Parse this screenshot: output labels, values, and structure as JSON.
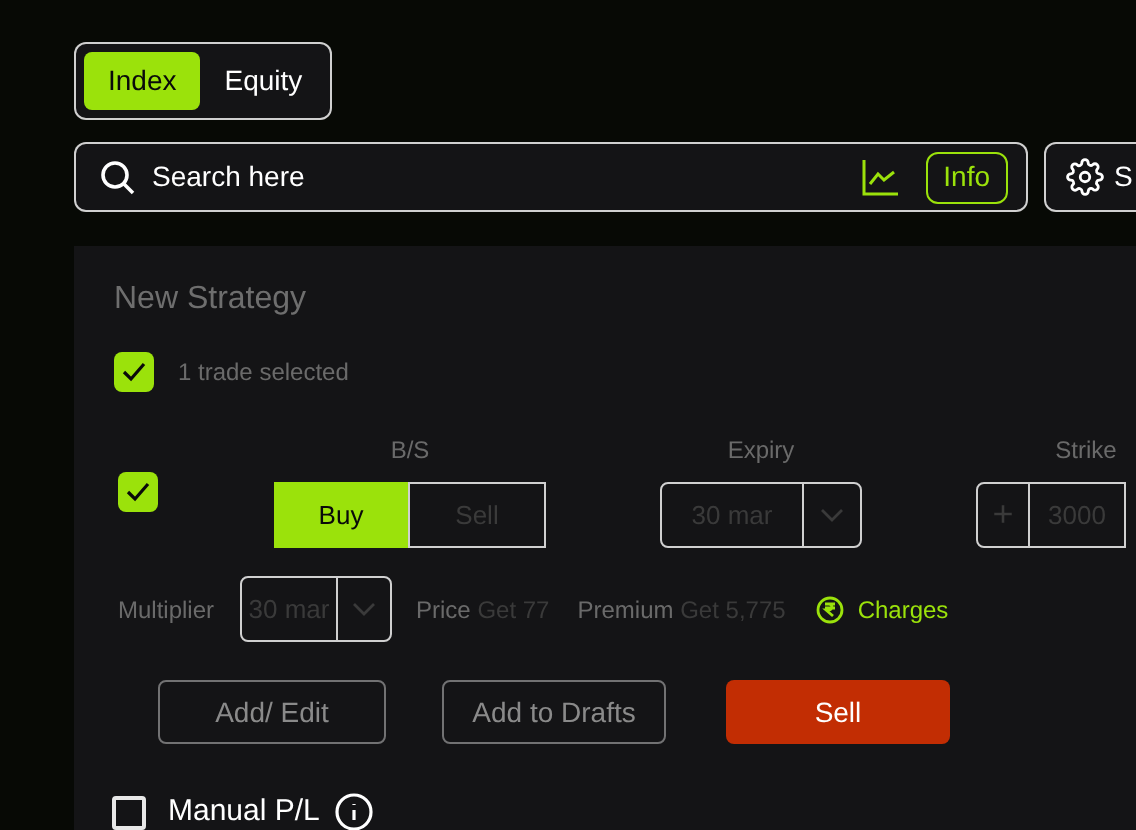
{
  "segment_tabs": [
    {
      "label": "Index",
      "selected": true
    },
    {
      "label": "Equity",
      "selected": false
    }
  ],
  "search": {
    "placeholder": "Search here",
    "info_button": "Info"
  },
  "settings_button": {
    "label": "S"
  },
  "strategy": {
    "title": "New Strategy",
    "select_all": {
      "checked": true,
      "label": "1 trade selected"
    },
    "trade": {
      "checked": true,
      "bs_label": "B/S",
      "bs_options": [
        {
          "label": "Buy",
          "selected": true
        },
        {
          "label": "Sell",
          "selected": false
        }
      ],
      "expiry_label": "Expiry",
      "expiry_value": "30 mar",
      "strike_label": "Strike",
      "strike_step": "+",
      "strike_value": "3000"
    },
    "multiplier": {
      "label": "Multiplier",
      "value": "30 mar"
    },
    "price": {
      "label": "Price",
      "value": "Get 77"
    },
    "premium": {
      "label": "Premium",
      "value": "Get 5,775"
    },
    "charges": "Charges",
    "actions": [
      {
        "label": "Add/ Edit",
        "kind": "outline"
      },
      {
        "label": "Add to Drafts",
        "kind": "outline"
      },
      {
        "label": "Sell",
        "kind": "danger"
      }
    ],
    "manual_pl": {
      "checked": false,
      "label": "Manual P/L"
    }
  }
}
